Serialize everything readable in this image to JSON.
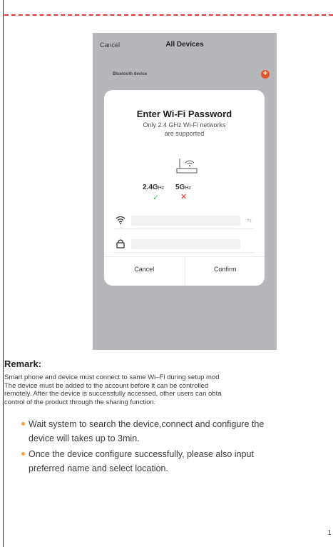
{
  "phone": {
    "top_cancel": "Cancel",
    "top_title": "All Devices",
    "bluetooth_label": "Bluetooth device",
    "add_symbol": "+",
    "modal": {
      "title": "Enter Wi-Fi Password",
      "subtitle_line1": "Only 2.4 GHz Wi-Fi networks",
      "subtitle_line2": "are supported",
      "band1_main": "2.4G",
      "band1_unit": "Hz",
      "band1_mark": "✓",
      "band2_main": "5G",
      "band2_unit": "Hz",
      "band2_mark": "✕",
      "swap_symbol": "⇆",
      "cancel_label": "Cancel",
      "confirm_label": "Confirm"
    }
  },
  "remark": {
    "heading": "Remark:",
    "lines": [
      "Smart phone and device must connect to same Wi–Fi during setup mod",
      "The device must be added to the account before it can be controlled",
      "remotely. After the device is successfully accessed, other users can obta",
      "control of the product through the sharing function."
    ]
  },
  "bullets": [
    {
      "line1": "Wait system to search the device,connect and configure the",
      "line2": "device will takes up to 3min."
    },
    {
      "line1": "Once the device configure successfully, please also input",
      "line2": "preferred name and select location."
    }
  ],
  "page_number": "1",
  "colors": {
    "dash": "#e03a3a",
    "bullet_dot": "#f2a24b",
    "add_button": "#e2542a",
    "check": "#4caf50",
    "cross": "#e53935"
  }
}
